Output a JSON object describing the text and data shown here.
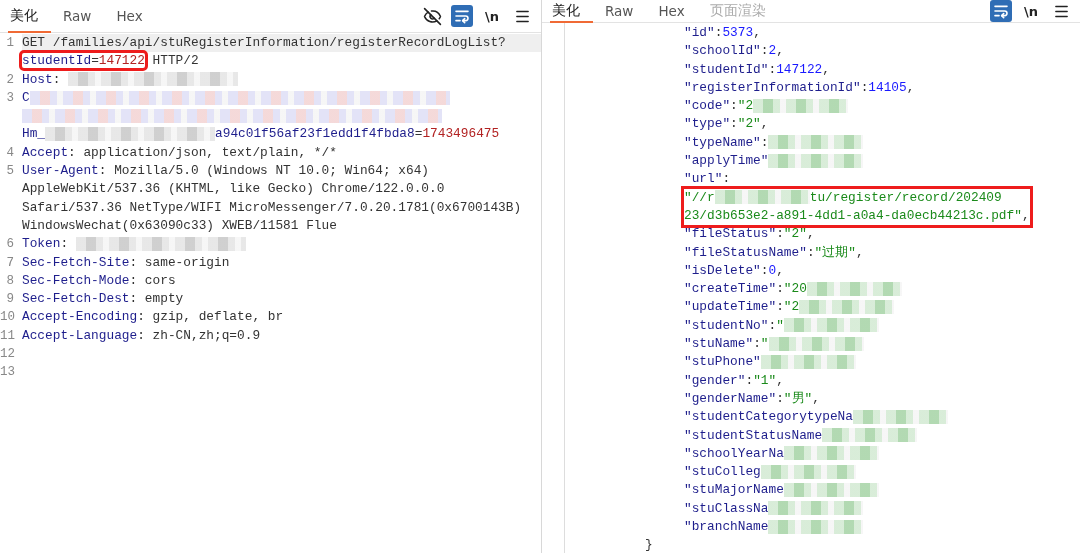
{
  "left": {
    "tabs": [
      {
        "label": "美化",
        "selected": true,
        "disabled": false
      },
      {
        "label": "Raw",
        "selected": false,
        "disabled": false
      },
      {
        "label": "Hex",
        "selected": false,
        "disabled": false
      }
    ],
    "tools": [
      {
        "kind": "eye-off",
        "selected": false
      },
      {
        "kind": "wrap",
        "selected": true
      },
      {
        "kind": "newline",
        "label": "\\n",
        "selected": false
      },
      {
        "kind": "menu",
        "selected": false
      }
    ],
    "lines": [
      {
        "number": "1",
        "current": true,
        "rows": [
          {
            "parts": [
              {
                "kind": "text",
                "text": "GET /families/api/stuRegisterInformation/registerRecordLogList?"
              }
            ]
          },
          {
            "parts": [
              {
                "kind": "key",
                "text": "studentId",
                "boxed": true
              },
              {
                "kind": "text",
                "text": "=",
                "boxed": true
              },
              {
                "kind": "value",
                "text": "147122",
                "boxed": true
              },
              {
                "kind": "text",
                "text": " HTTP/2"
              }
            ]
          }
        ]
      },
      {
        "number": "2",
        "current": false,
        "rows": [
          {
            "parts": [
              {
                "kind": "key",
                "text": "Host"
              },
              {
                "kind": "text",
                "text": ": "
              },
              {
                "kind": "mask"
              }
            ]
          }
        ]
      },
      {
        "number": "3",
        "current": false,
        "rows": [
          {
            "parts": [
              {
                "kind": "key",
                "text": "C"
              },
              {
                "kind": "mask"
              }
            ]
          },
          {
            "parts": [
              {
                "kind": "mask"
              }
            ]
          },
          {
            "parts": [
              {
                "kind": "key",
                "text": "Hm_"
              },
              {
                "kind": "mask"
              },
              {
                "kind": "key",
                "text": "a94c01f56af23f1edd1f4fbda8"
              },
              {
                "kind": "text",
                "text": "="
              },
              {
                "kind": "value",
                "text": "1743496475"
              }
            ]
          }
        ]
      },
      {
        "number": "4",
        "current": false,
        "rows": [
          {
            "parts": [
              {
                "kind": "key",
                "text": "Accept"
              },
              {
                "kind": "text",
                "text": ": application/json, text/plain, */*"
              }
            ]
          }
        ]
      },
      {
        "number": "5",
        "current": false,
        "rows": [
          {
            "parts": [
              {
                "kind": "key",
                "text": "User-Agent"
              },
              {
                "kind": "text",
                "text": ": Mozilla/5.0 (Windows NT 10.0; Win64; x64)"
              }
            ]
          },
          {
            "parts": [
              {
                "kind": "text",
                "text": "AppleWebKit/537.36 (KHTML, like Gecko) Chrome/122.0.0.0"
              }
            ]
          },
          {
            "parts": [
              {
                "kind": "text",
                "text": "Safari/537.36 NetType/WIFI MicroMessenger/7.0.20.1781(0x6700143B)"
              }
            ]
          },
          {
            "parts": [
              {
                "kind": "text",
                "text": "WindowsWechat(0x63090c33) XWEB/11581 Flue"
              }
            ]
          }
        ]
      },
      {
        "number": "6",
        "current": false,
        "rows": [
          {
            "parts": [
              {
                "kind": "key",
                "text": "Token"
              },
              {
                "kind": "text",
                "text": ": "
              },
              {
                "kind": "mask"
              }
            ]
          }
        ]
      },
      {
        "number": "7",
        "current": false,
        "rows": [
          {
            "parts": [
              {
                "kind": "key",
                "text": "Sec-Fetch-Site"
              },
              {
                "kind": "text",
                "text": ": same-origin"
              }
            ]
          }
        ]
      },
      {
        "number": "8",
        "current": false,
        "rows": [
          {
            "parts": [
              {
                "kind": "key",
                "text": "Sec-Fetch-Mode"
              },
              {
                "kind": "text",
                "text": ": cors"
              }
            ]
          }
        ]
      },
      {
        "number": "9",
        "current": false,
        "rows": [
          {
            "parts": [
              {
                "kind": "key",
                "text": "Sec-Fetch-Dest"
              },
              {
                "kind": "text",
                "text": ": empty"
              }
            ]
          }
        ]
      },
      {
        "number": "10",
        "current": false,
        "rows": [
          {
            "parts": [
              {
                "kind": "key",
                "text": "Accept-Encoding"
              },
              {
                "kind": "text",
                "text": ": gzip, deflate, br"
              }
            ]
          }
        ]
      },
      {
        "number": "11",
        "current": false,
        "rows": [
          {
            "parts": [
              {
                "kind": "key",
                "text": "Accept-Language"
              },
              {
                "kind": "text",
                "text": ": zh-CN,zh;q=0.9"
              }
            ]
          }
        ]
      },
      {
        "number": "12",
        "current": false,
        "rows": [
          {
            "parts": []
          }
        ]
      },
      {
        "number": "13",
        "current": false,
        "rows": [
          {
            "parts": []
          }
        ]
      }
    ]
  },
  "right": {
    "tabs": [
      {
        "label": "美化",
        "selected": true,
        "disabled": false
      },
      {
        "label": "Raw",
        "selected": false,
        "disabled": false
      },
      {
        "label": "Hex",
        "selected": false,
        "disabled": false
      },
      {
        "label": "页面渲染",
        "selected": false,
        "disabled": true
      }
    ],
    "tools": [
      {
        "kind": "wrap",
        "selected": true
      },
      {
        "kind": "newline",
        "label": "\\n",
        "selected": false
      },
      {
        "kind": "menu",
        "selected": false
      }
    ],
    "object": {
      "lines": [
        {
          "boxed": false,
          "parts": [
            {
              "kind": "key",
              "text": "\"id\""
            },
            {
              "kind": "text",
              "text": ":"
            },
            {
              "kind": "number",
              "text": "5373"
            },
            {
              "kind": "text",
              "text": ","
            }
          ]
        },
        {
          "boxed": false,
          "parts": [
            {
              "kind": "key",
              "text": "\"schoolId\""
            },
            {
              "kind": "text",
              "text": ":"
            },
            {
              "kind": "number",
              "text": "2"
            },
            {
              "kind": "text",
              "text": ","
            }
          ]
        },
        {
          "boxed": false,
          "parts": [
            {
              "kind": "key",
              "text": "\"studentId\""
            },
            {
              "kind": "text",
              "text": ":"
            },
            {
              "kind": "number",
              "text": "147122"
            },
            {
              "kind": "text",
              "text": ","
            }
          ]
        },
        {
          "boxed": false,
          "parts": [
            {
              "kind": "key",
              "text": "\"registerInformationId\""
            },
            {
              "kind": "text",
              "text": ":"
            },
            {
              "kind": "number",
              "text": "14105"
            },
            {
              "kind": "text",
              "text": ","
            }
          ]
        },
        {
          "boxed": false,
          "parts": [
            {
              "kind": "key",
              "text": "\"code\""
            },
            {
              "kind": "text",
              "text": ":"
            },
            {
              "kind": "string",
              "text": "\"2"
            },
            {
              "kind": "mask"
            }
          ]
        },
        {
          "boxed": false,
          "parts": [
            {
              "kind": "key",
              "text": "\"type\""
            },
            {
              "kind": "text",
              "text": ":"
            },
            {
              "kind": "string",
              "text": "\"2\""
            },
            {
              "kind": "text",
              "text": ","
            }
          ]
        },
        {
          "boxed": false,
          "parts": [
            {
              "kind": "key",
              "text": "\"typeName\""
            },
            {
              "kind": "text",
              "text": ":"
            },
            {
              "kind": "mask"
            }
          ]
        },
        {
          "boxed": false,
          "parts": [
            {
              "kind": "key",
              "text": "\"applyTime\""
            },
            {
              "kind": "mask"
            }
          ]
        },
        {
          "boxed": false,
          "parts": [
            {
              "kind": "key",
              "text": "\"url\""
            },
            {
              "kind": "text",
              "text": ":"
            }
          ]
        },
        {
          "boxed": true,
          "parts": [
            {
              "kind": "string",
              "text": "\"//r"
            },
            {
              "kind": "mask"
            },
            {
              "kind": "string",
              "text": "tu/register/record/202409"
            }
          ]
        },
        {
          "boxed": true,
          "parts": [
            {
              "kind": "string",
              "text": "23/d3b653e2-a891-4dd1-a0a4-da0ecb44213c.pdf\""
            },
            {
              "kind": "text",
              "text": ","
            }
          ]
        },
        {
          "boxed": false,
          "parts": [
            {
              "kind": "key",
              "text": "\"fileStatus\""
            },
            {
              "kind": "text",
              "text": ":"
            },
            {
              "kind": "string",
              "text": "\"2\""
            },
            {
              "kind": "text",
              "text": ","
            }
          ]
        },
        {
          "boxed": false,
          "parts": [
            {
              "kind": "key",
              "text": "\"fileStatusName\""
            },
            {
              "kind": "text",
              "text": ":"
            },
            {
              "kind": "string",
              "text": "\"过期\""
            },
            {
              "kind": "text",
              "text": ","
            }
          ]
        },
        {
          "boxed": false,
          "parts": [
            {
              "kind": "key",
              "text": "\"isDelete\""
            },
            {
              "kind": "text",
              "text": ":"
            },
            {
              "kind": "number",
              "text": "0"
            },
            {
              "kind": "text",
              "text": ","
            }
          ]
        },
        {
          "boxed": false,
          "parts": [
            {
              "kind": "key",
              "text": "\"createTime\""
            },
            {
              "kind": "text",
              "text": ":"
            },
            {
              "kind": "string",
              "text": "\"20"
            },
            {
              "kind": "mask"
            }
          ]
        },
        {
          "boxed": false,
          "parts": [
            {
              "kind": "key",
              "text": "\"updateTime\""
            },
            {
              "kind": "text",
              "text": ":"
            },
            {
              "kind": "string",
              "text": "\"2"
            },
            {
              "kind": "mask"
            }
          ]
        },
        {
          "boxed": false,
          "parts": [
            {
              "kind": "key",
              "text": "\"studentNo\""
            },
            {
              "kind": "text",
              "text": ":"
            },
            {
              "kind": "string",
              "text": "\""
            },
            {
              "kind": "mask"
            }
          ]
        },
        {
          "boxed": false,
          "parts": [
            {
              "kind": "key",
              "text": "\"stuName\""
            },
            {
              "kind": "text",
              "text": ":"
            },
            {
              "kind": "string",
              "text": "\""
            },
            {
              "kind": "mask"
            }
          ]
        },
        {
          "boxed": false,
          "parts": [
            {
              "kind": "key",
              "text": "\"stuPhone\""
            },
            {
              "kind": "mask"
            }
          ]
        },
        {
          "boxed": false,
          "parts": [
            {
              "kind": "key",
              "text": "\"gender\""
            },
            {
              "kind": "text",
              "text": ":"
            },
            {
              "kind": "string",
              "text": "\"1\""
            },
            {
              "kind": "text",
              "text": ","
            }
          ]
        },
        {
          "boxed": false,
          "parts": [
            {
              "kind": "key",
              "text": "\"genderName\""
            },
            {
              "kind": "text",
              "text": ":"
            },
            {
              "kind": "string",
              "text": "\"男\""
            },
            {
              "kind": "text",
              "text": ","
            }
          ]
        },
        {
          "boxed": false,
          "parts": [
            {
              "kind": "key",
              "text": "\"studentCategorytypeNa"
            },
            {
              "kind": "mask"
            }
          ]
        },
        {
          "boxed": false,
          "parts": [
            {
              "kind": "key",
              "text": "\"studentStatusName"
            },
            {
              "kind": "mask"
            }
          ]
        },
        {
          "boxed": false,
          "parts": [
            {
              "kind": "key",
              "text": "\"schoolYearNa"
            },
            {
              "kind": "mask"
            }
          ]
        },
        {
          "boxed": false,
          "parts": [
            {
              "kind": "key",
              "text": "\"stuColleg"
            },
            {
              "kind": "mask"
            }
          ]
        },
        {
          "boxed": false,
          "parts": [
            {
              "kind": "key",
              "text": "\"stuMajorName"
            },
            {
              "kind": "mask"
            }
          ]
        },
        {
          "boxed": false,
          "parts": [
            {
              "kind": "key",
              "text": "\"stuClassNa"
            },
            {
              "kind": "mask"
            }
          ]
        },
        {
          "boxed": false,
          "parts": [
            {
              "kind": "key",
              "text": "\"branchName"
            },
            {
              "kind": "mask"
            }
          ]
        }
      ],
      "closing": "}"
    }
  }
}
